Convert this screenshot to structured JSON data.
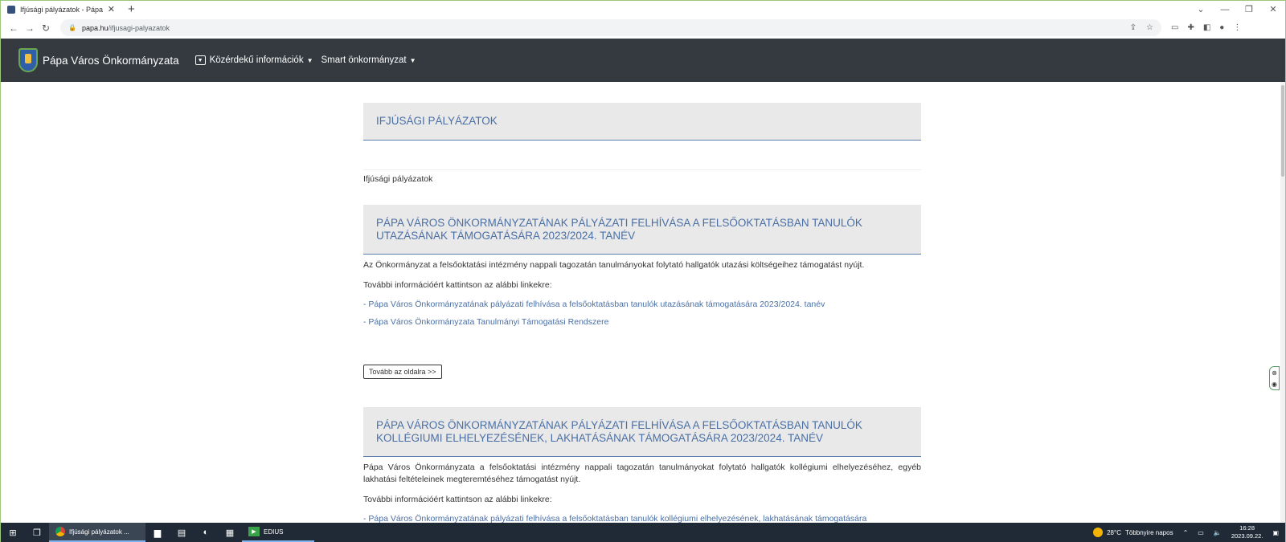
{
  "browser": {
    "tab_title": "Ifjúsági pályázatok - Pápa Város",
    "tab_close": "✕",
    "new_tab": "+",
    "url_host": "papa.hu",
    "url_path": "/ifjusagi-palyazatok",
    "window_controls": [
      "⌄",
      "—",
      "❐",
      "✕"
    ]
  },
  "site": {
    "name": "Pápa Város Önkormányzata",
    "nav": [
      {
        "label": "Közérdekű információk",
        "caret": "▼"
      },
      {
        "label": "Smart önkormányzat",
        "caret": "▼"
      }
    ]
  },
  "page": {
    "title": "IFJÚSÁGI PÁLYÁZATOK",
    "breadcrumb": "Ifjúsági pályázatok",
    "articles": [
      {
        "title": "PÁPA VÁROS ÖNKORMÁNYZATÁNAK PÁLYÁZATI FELHÍVÁSA A FELSŐOKTATÁSBAN TANULÓK UTAZÁSÁNAK TÁMOGATÁSÁRA 2023/2024. TANÉV",
        "body": "Az Önkormányzat a felsőoktatási intézmény nappali tagozatán tanulmányokat folytató hallgatók utazási költségeihez támogatást nyújt.",
        "links_intro": "További információért kattintson az alábbi linkekre:",
        "links": [
          "- Pápa Város Önkormányzatának pályázati felhívása a felsőoktatásban tanulók utazásának támogatására 2023/2024. tanév",
          "- Pápa Város Önkormányzata Tanulmányi Támogatási Rendszere"
        ],
        "more_button": "Tovább az oldalra >>"
      },
      {
        "title": "PÁPA VÁROS ÖNKORMÁNYZATÁNAK PÁLYÁZATI FELHÍVÁSA A FELSŐOKTATÁSBAN TANULÓK KOLLÉGIUMI ELHELYEZÉSÉNEK, LAKHATÁSÁNAK TÁMOGATÁSÁRA 2023/2024. TANÉV",
        "body": "Pápa Város Önkormányzata a felsőoktatási intézmény nappali tagozatán tanulmányokat folytató hallgatók kollégiumi elhelyezéséhez, egyéb lakhatási feltételeinek megteremtéséhez támogatást nyújt.",
        "links_intro": "További információért kattintson az alábbi linkekre:",
        "links": [
          "- Pápa Város Önkormányzatának pályázati felhívása a felsőoktatásban tanulók kollégiumi elhelyezésének, lakhatásának támogatására"
        ]
      }
    ]
  },
  "taskbar": {
    "active_app": "Ifjúsági pályázatok ...",
    "edius_app": "EDIUS",
    "temperature": "28°C",
    "weather": "Többnyire napos",
    "time": "16:28",
    "date": "2023.09.22."
  }
}
